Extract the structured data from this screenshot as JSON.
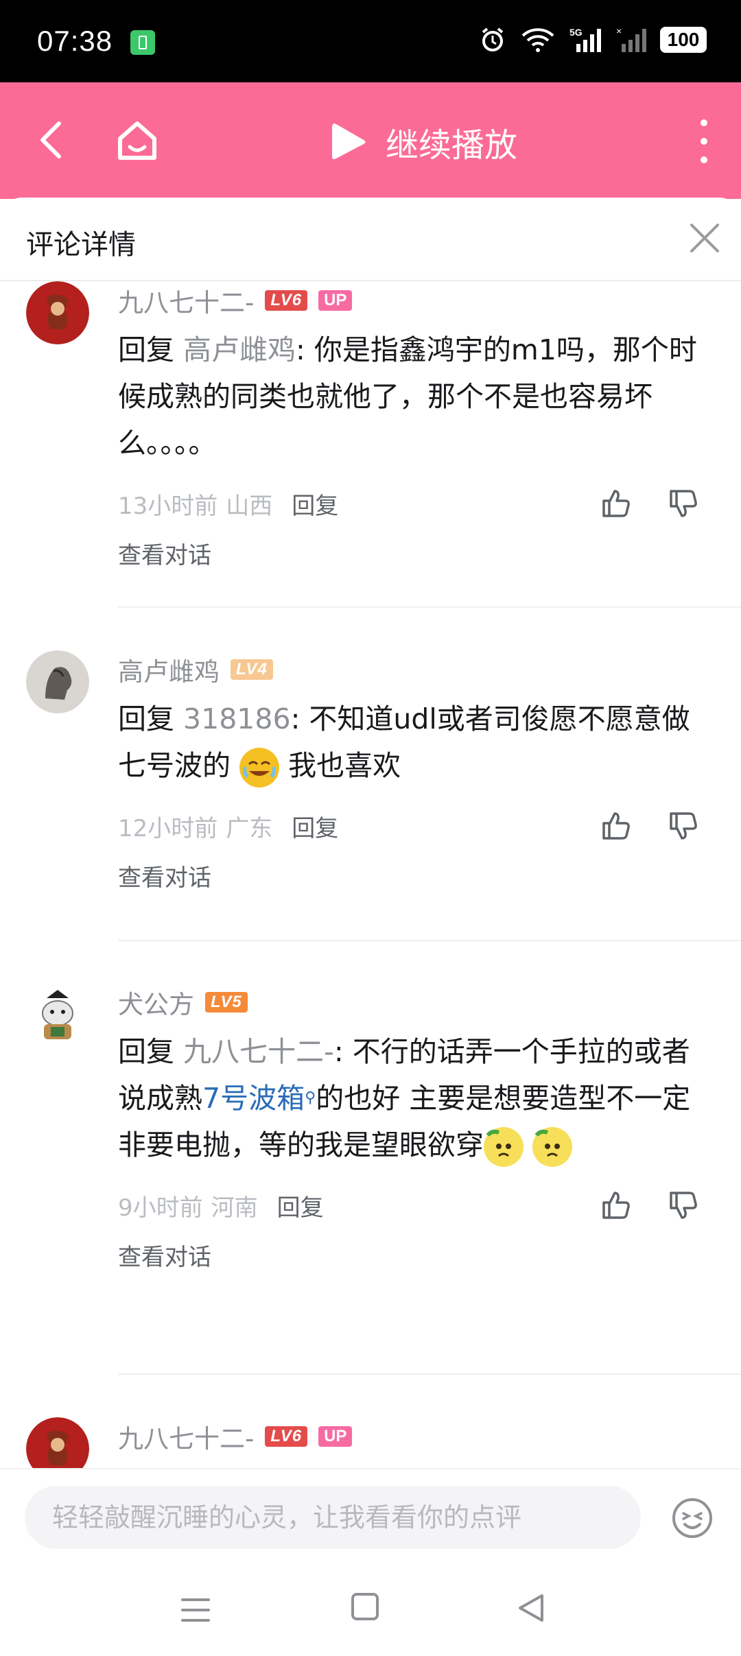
{
  "status_bar": {
    "time": "07:38",
    "battery": "100",
    "network": "5G"
  },
  "header": {
    "play_label": "继续播放"
  },
  "sheet": {
    "title": "评论详情"
  },
  "comments": [
    {
      "username": "九八七十二-",
      "level": "LV6",
      "up_badge": "UP",
      "reply_prefix": "回复 ",
      "mention": "高卢雌鸡",
      "text": ": 你是指鑫鸿宇的m1吗，那个时候成熟的同类也就他了，那个不是也容易坏么。。。。",
      "time": "13小时前",
      "location": "山西",
      "reply_label": "回复",
      "view_conversation": "查看对话"
    },
    {
      "username": "高卢雌鸡",
      "level": "LV4",
      "reply_prefix": "回复 ",
      "mention": "318186",
      "text": ": 不知道udl或者司俊愿不愿意做七号波的",
      "text_after_emoji": " 我也喜欢",
      "time": "12小时前",
      "location": "广东",
      "reply_label": "回复",
      "view_conversation": "查看对话"
    },
    {
      "username": "犬公方",
      "level": "LV5",
      "reply_prefix": "回复 ",
      "mention": "九八七十二-",
      "text": ": 不行的话弄一个手拉的或者说成熟",
      "link": "7号波箱",
      "text_after_link": "的也好 主要是想要造型不一定非要电抛，等的我是望眼欲穿",
      "time": "9小时前",
      "location": "河南",
      "reply_label": "回复",
      "view_conversation": "查看对话"
    },
    {
      "username": "九八七十二-",
      "level": "LV6",
      "up_badge": "UP"
    }
  ],
  "input": {
    "placeholder": "轻轻敲醒沉睡的心灵，让我看看你的点评"
  },
  "colors": {
    "brand_pink": "#fb6b96",
    "link_blue": "#2a6cb6",
    "lv6": "#e44c4c",
    "lv5": "#f58a3a",
    "lv4": "#f7c891"
  }
}
